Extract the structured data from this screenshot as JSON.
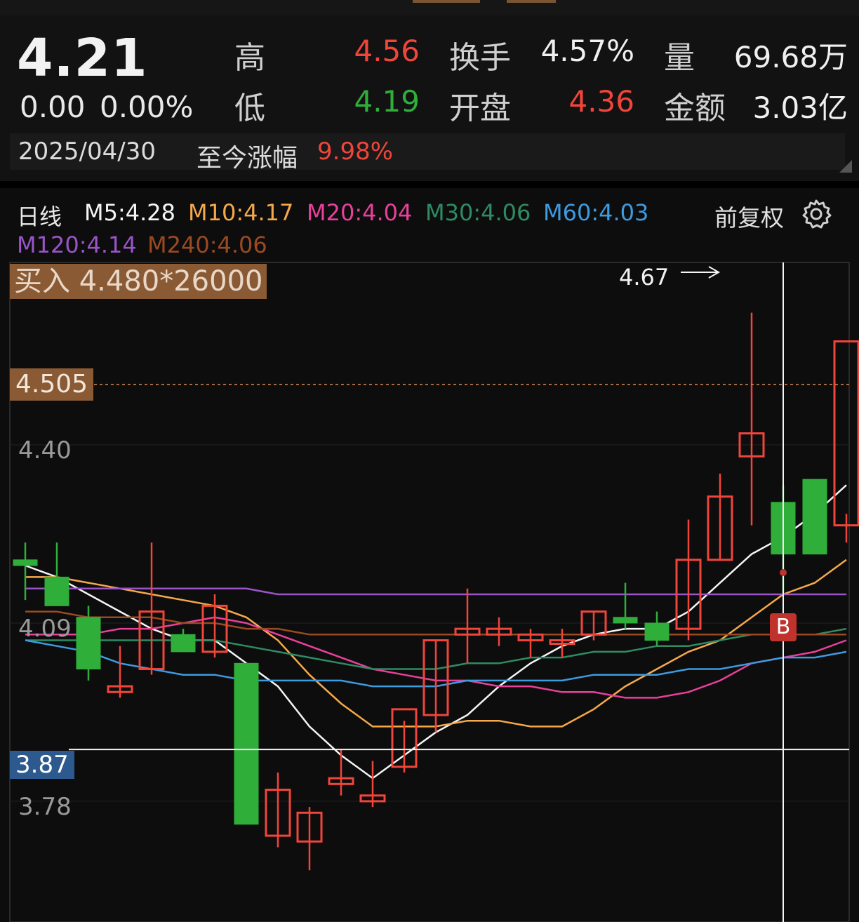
{
  "quote": {
    "price": "4.21",
    "change": "0.00",
    "change_pct": "0.00%",
    "high_label": "高",
    "high": "4.56",
    "low_label": "低",
    "low": "4.19",
    "turnover_label": "换手",
    "turnover": "4.57%",
    "open_label": "开盘",
    "open": "4.36",
    "volume_label": "量",
    "volume": "69.68万",
    "amount_label": "金额",
    "amount": "3.03亿",
    "date": "2025/04/30",
    "since_label": "至今涨幅",
    "since_value": "9.98%"
  },
  "indicators": {
    "period": "日线",
    "m5": "M5:4.28",
    "m10": "M10:4.17",
    "m20": "M20:4.04",
    "m30": "M30:4.06",
    "m60": "M60:4.03",
    "m120": "M120:4.14",
    "m240": "M240:4.06",
    "adjust": "前复权"
  },
  "tags": {
    "buy": "买入 4.480*26000",
    "price_line_1": "4.505",
    "cursor_price": "3.87",
    "high_marker": "4.67",
    "b_marker": "B"
  },
  "colors": {
    "up": "#f0453a",
    "down": "#2fae3a",
    "m5": "#f5f5f5",
    "m10": "#f6a94a",
    "m20": "#e8409c",
    "m30": "#2e8b63",
    "m60": "#3d9be0",
    "m120": "#9a54c8",
    "m240": "#9a4a22"
  },
  "chart_data": {
    "type": "candlestick",
    "y_ticks": [
      "4.40",
      "4.09",
      "3.78"
    ],
    "ylim": [
      3.66,
      4.67
    ],
    "reference_lines": [
      {
        "label": "4.505",
        "value": 4.505,
        "style": "dashed"
      },
      {
        "label": "3.87",
        "value": 3.87,
        "style": "solid"
      }
    ],
    "candles": [
      {
        "o": 4.2,
        "h": 4.23,
        "l": 4.13,
        "c": 4.19
      },
      {
        "o": 4.17,
        "h": 4.23,
        "l": 4.12,
        "c": 4.12
      },
      {
        "o": 4.1,
        "h": 4.12,
        "l": 3.99,
        "c": 4.01
      },
      {
        "o": 3.97,
        "h": 4.05,
        "l": 3.96,
        "c": 3.98
      },
      {
        "o": 4.01,
        "h": 4.23,
        "l": 4.0,
        "c": 4.11
      },
      {
        "o": 4.07,
        "h": 4.08,
        "l": 4.04,
        "c": 4.04
      },
      {
        "o": 4.04,
        "h": 4.14,
        "l": 4.03,
        "c": 4.12
      },
      {
        "o": 4.02,
        "h": 4.02,
        "l": 3.74,
        "c": 3.74
      },
      {
        "o": 3.72,
        "h": 3.83,
        "l": 3.7,
        "c": 3.8
      },
      {
        "o": 3.71,
        "h": 3.77,
        "l": 3.66,
        "c": 3.76
      },
      {
        "o": 3.81,
        "h": 3.87,
        "l": 3.79,
        "c": 3.82
      },
      {
        "o": 3.78,
        "h": 3.85,
        "l": 3.77,
        "c": 3.79
      },
      {
        "o": 3.84,
        "h": 3.92,
        "l": 3.83,
        "c": 3.94
      },
      {
        "o": 3.93,
        "h": 4.06,
        "l": 3.9,
        "c": 4.06
      },
      {
        "o": 4.07,
        "h": 4.15,
        "l": 4.02,
        "c": 4.08
      },
      {
        "o": 4.07,
        "h": 4.1,
        "l": 4.05,
        "c": 4.08
      },
      {
        "o": 4.06,
        "h": 4.08,
        "l": 4.03,
        "c": 4.07
      },
      {
        "o": 4.06,
        "h": 4.08,
        "l": 4.03,
        "c": 4.06
      },
      {
        "o": 4.07,
        "h": 4.11,
        "l": 4.06,
        "c": 4.11
      },
      {
        "o": 4.1,
        "h": 4.16,
        "l": 4.08,
        "c": 4.09
      },
      {
        "o": 4.09,
        "h": 4.11,
        "l": 4.05,
        "c": 4.06
      },
      {
        "o": 4.08,
        "h": 4.27,
        "l": 4.06,
        "c": 4.2
      },
      {
        "o": 4.2,
        "h": 4.35,
        "l": 4.2,
        "c": 4.31
      },
      {
        "o": 4.38,
        "h": 4.63,
        "l": 4.26,
        "c": 4.42
      },
      {
        "o": 4.3,
        "h": 4.33,
        "l": 4.14,
        "c": 4.21
      },
      {
        "o": 4.34,
        "h": 4.34,
        "l": 4.21,
        "c": 4.21
      },
      {
        "o": 4.26,
        "h": 4.28,
        "l": 4.23,
        "c": 4.58
      }
    ],
    "ma_series": [
      {
        "name": "M5",
        "values": [
          4.19,
          4.17,
          4.14,
          4.11,
          4.08,
          4.06,
          4.06,
          4.02,
          3.98,
          3.91,
          3.86,
          3.82,
          3.86,
          3.9,
          3.93,
          3.98,
          4.02,
          4.05,
          4.07,
          4.08,
          4.08,
          4.11,
          4.16,
          4.21,
          4.24,
          4.28,
          4.33
        ]
      },
      {
        "name": "M10",
        "values": [
          4.17,
          4.17,
          4.16,
          4.15,
          4.14,
          4.13,
          4.12,
          4.1,
          4.06,
          4.0,
          3.95,
          3.91,
          3.91,
          3.91,
          3.92,
          3.92,
          3.91,
          3.91,
          3.94,
          3.98,
          4.01,
          4.04,
          4.06,
          4.1,
          4.14,
          4.16,
          4.2
        ]
      },
      {
        "name": "M20",
        "values": [
          4.07,
          4.07,
          4.07,
          4.08,
          4.08,
          4.09,
          4.1,
          4.09,
          4.07,
          4.05,
          4.03,
          4.01,
          4.0,
          3.99,
          3.99,
          3.98,
          3.98,
          3.97,
          3.97,
          3.96,
          3.96,
          3.97,
          3.99,
          4.02,
          4.03,
          4.04,
          4.06
        ]
      },
      {
        "name": "M30",
        "values": [
          4.06,
          4.06,
          4.06,
          4.06,
          4.06,
          4.06,
          4.06,
          4.05,
          4.04,
          4.03,
          4.02,
          4.01,
          4.01,
          4.01,
          4.02,
          4.02,
          4.03,
          4.03,
          4.04,
          4.04,
          4.05,
          4.05,
          4.06,
          4.07,
          4.07,
          4.07,
          4.08
        ]
      },
      {
        "name": "M60",
        "values": [
          4.06,
          4.05,
          4.04,
          4.02,
          4.01,
          4.0,
          4.0,
          3.99,
          3.99,
          3.99,
          3.99,
          3.98,
          3.98,
          3.98,
          3.99,
          3.99,
          3.99,
          3.99,
          4.0,
          4.0,
          4.0,
          4.01,
          4.01,
          4.02,
          4.03,
          4.03,
          4.04
        ]
      },
      {
        "name": "M120",
        "values": [
          4.15,
          4.15,
          4.15,
          4.15,
          4.15,
          4.15,
          4.15,
          4.15,
          4.14,
          4.14,
          4.14,
          4.14,
          4.14,
          4.14,
          4.14,
          4.14,
          4.14,
          4.14,
          4.14,
          4.14,
          4.14,
          4.14,
          4.14,
          4.14,
          4.14,
          4.14,
          4.14
        ]
      },
      {
        "name": "M240",
        "values": [
          4.11,
          4.11,
          4.1,
          4.1,
          4.1,
          4.09,
          4.09,
          4.08,
          4.08,
          4.07,
          4.07,
          4.07,
          4.07,
          4.07,
          4.07,
          4.07,
          4.07,
          4.07,
          4.07,
          4.07,
          4.07,
          4.07,
          4.07,
          4.07,
          4.07,
          4.07,
          4.07
        ]
      }
    ]
  }
}
